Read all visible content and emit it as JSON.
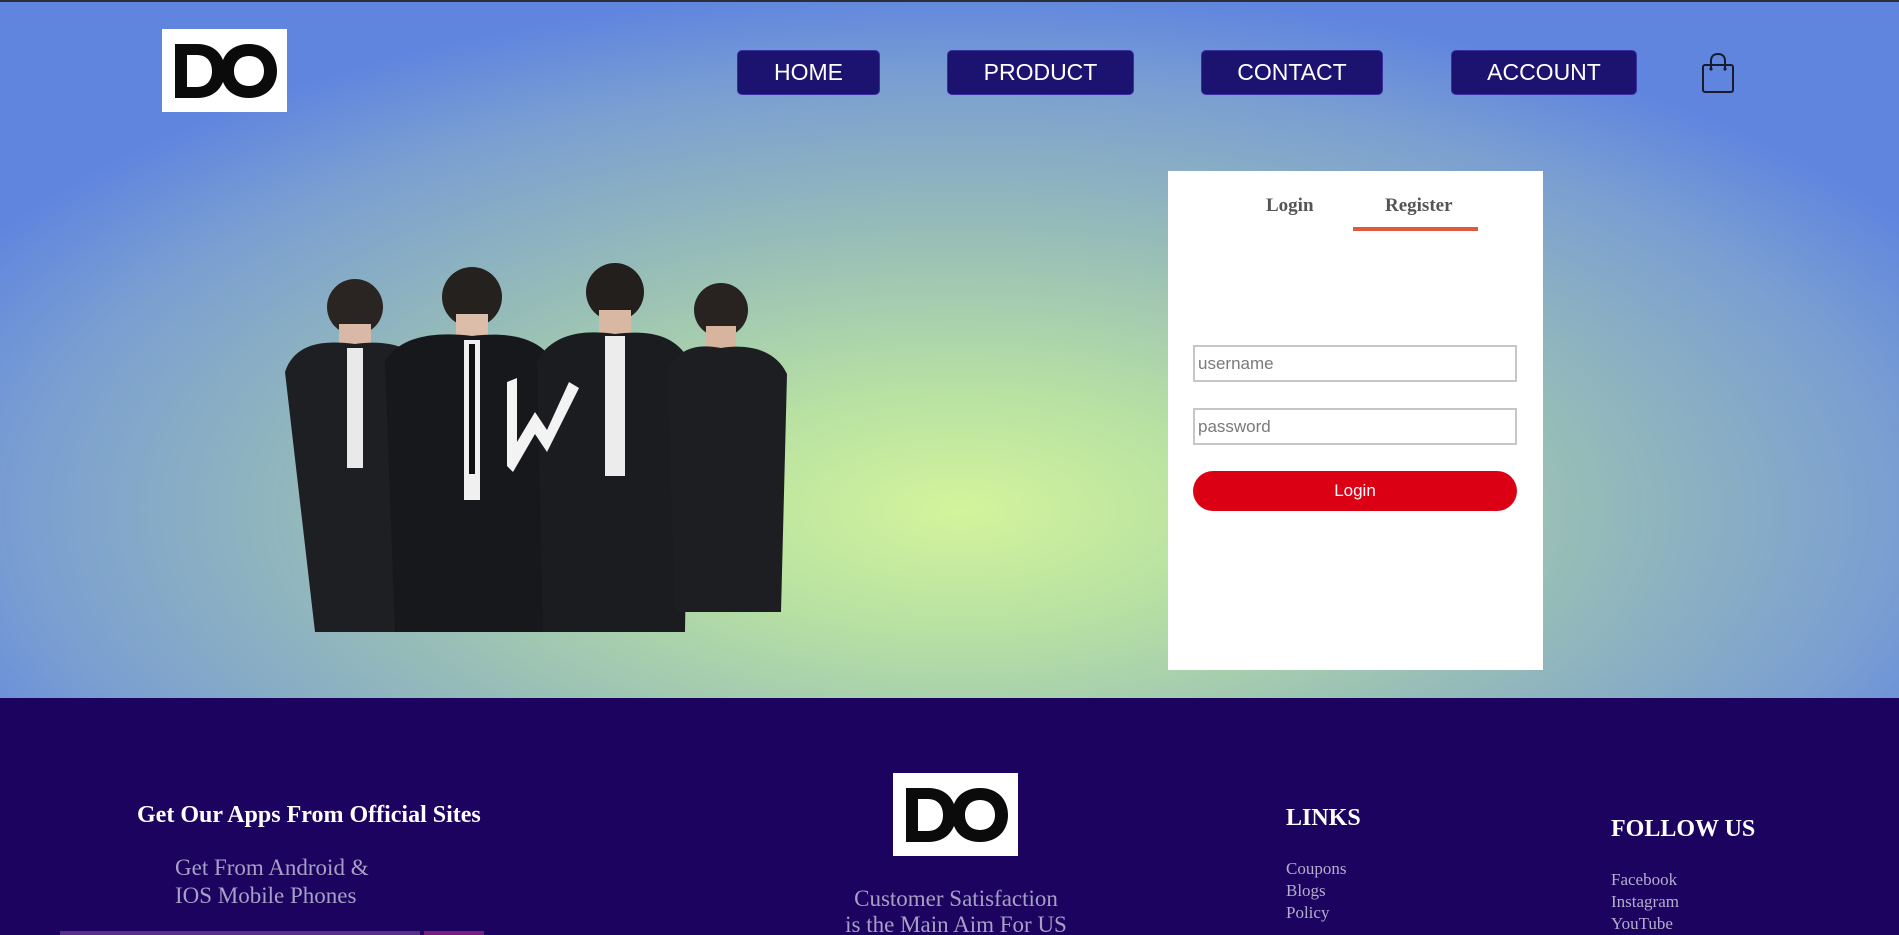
{
  "brand": {
    "logo_text": "DO"
  },
  "nav": {
    "items": [
      {
        "label": "HOME"
      },
      {
        "label": "PRODUCT"
      },
      {
        "label": "CONTACT"
      },
      {
        "label": "ACCOUNT"
      }
    ],
    "cart_icon": "shopping-bag-icon"
  },
  "login_card": {
    "tabs": [
      {
        "label": "Login"
      },
      {
        "label": "Register",
        "active": true
      }
    ],
    "username_placeholder": "username",
    "password_placeholder": "password",
    "submit_label": "Login"
  },
  "footer": {
    "apps": {
      "heading": "Get Our Apps From Official Sites",
      "line1": "Get From Android &",
      "line2": "IOS Mobile Phones"
    },
    "center": {
      "line1": "Customer Satisfaction",
      "line2": "is the Main Aim For US"
    },
    "links": {
      "heading": "LINKS",
      "items": [
        "Coupons",
        "Blogs",
        "Policy"
      ]
    },
    "follow": {
      "heading": "FOLLOW US",
      "items": [
        "Facebook",
        "Instagram",
        "YouTube"
      ]
    }
  },
  "colors": {
    "nav_bg": "#1c1370",
    "footer_bg": "#1c0360",
    "login_button": "#dc0015",
    "tab_underline": "#e05a3c"
  }
}
